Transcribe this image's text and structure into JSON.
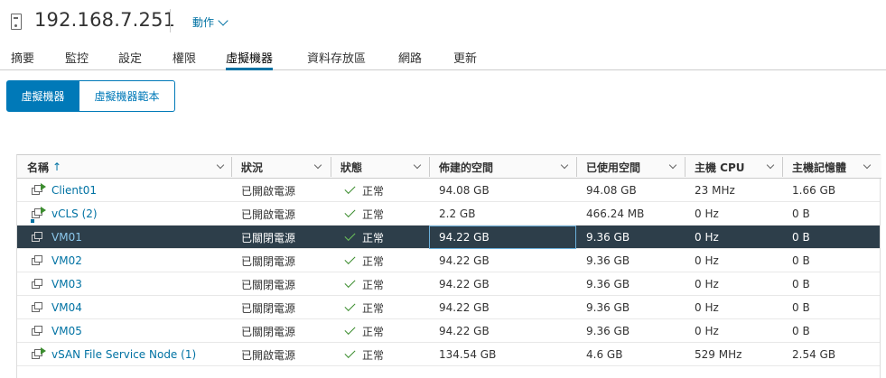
{
  "header": {
    "host": "192.168.7.251",
    "actions_label": "動作"
  },
  "tabs": [
    "摘要",
    "監控",
    "設定",
    "權限",
    "虛擬機器",
    "資料存放區",
    "網路",
    "更新"
  ],
  "active_tab": "虛擬機器",
  "toggle": {
    "vms_label": "虛擬機器",
    "templates_label": "虛擬機器範本"
  },
  "columns": [
    "名稱",
    "狀況",
    "狀態",
    "佈建的空間",
    "已使用空間",
    "主機 CPU",
    "主機記憶體"
  ],
  "sort_indicator": "↑",
  "rows": [
    {
      "name": "Client01",
      "power": "已開啟電源",
      "status": "正常",
      "provisioned": "94.08 GB",
      "used": "94.08 GB",
      "cpu": "23 MHz",
      "mem": "1.66 GB",
      "icon": "vm-powered-on-icon"
    },
    {
      "name": "vCLS (2)",
      "power": "已開啟電源",
      "status": "正常",
      "provisioned": "2.2 GB",
      "used": "466.24 MB",
      "cpu": "0 Hz",
      "mem": "0 B",
      "icon": "vcls-vm-icon"
    },
    {
      "name": "VM01",
      "power": "已關閉電源",
      "status": "正常",
      "provisioned": "94.22 GB",
      "used": "9.36 GB",
      "cpu": "0 Hz",
      "mem": "0 B",
      "icon": "vm-powered-off-icon"
    },
    {
      "name": "VM02",
      "power": "已關閉電源",
      "status": "正常",
      "provisioned": "94.22 GB",
      "used": "9.36 GB",
      "cpu": "0 Hz",
      "mem": "0 B",
      "icon": "vm-powered-off-icon"
    },
    {
      "name": "VM03",
      "power": "已關閉電源",
      "status": "正常",
      "provisioned": "94.22 GB",
      "used": "9.36 GB",
      "cpu": "0 Hz",
      "mem": "0 B",
      "icon": "vm-powered-off-icon"
    },
    {
      "name": "VM04",
      "power": "已關閉電源",
      "status": "正常",
      "provisioned": "94.22 GB",
      "used": "9.36 GB",
      "cpu": "0 Hz",
      "mem": "0 B",
      "icon": "vm-powered-off-icon"
    },
    {
      "name": "VM05",
      "power": "已關閉電源",
      "status": "正常",
      "provisioned": "94.22 GB",
      "used": "9.36 GB",
      "cpu": "0 Hz",
      "mem": "0 B",
      "icon": "vm-powered-off-icon"
    },
    {
      "name": "vSAN File Service Node (1)",
      "power": "已開啟電源",
      "status": "正常",
      "provisioned": "134.54 GB",
      "used": "4.6 GB",
      "cpu": "529 MHz",
      "mem": "2.54 GB",
      "icon": "vm-powered-on-icon"
    }
  ],
  "selected_row": 2,
  "colors": {
    "accent": "#0072a3",
    "selected_row_bg": "#2d3e4a",
    "status_ok": "#3c8d2f"
  }
}
